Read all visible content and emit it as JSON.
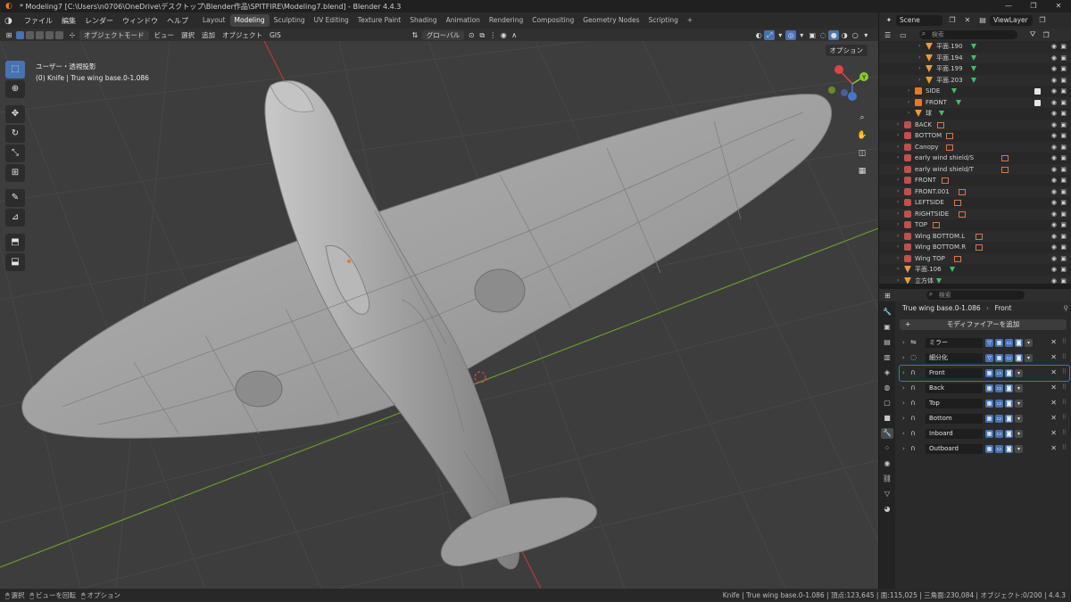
{
  "window": {
    "title": "* Modeling7 [C:\\Users\\n0706\\OneDrive\\デスクトップ\\Blender作品\\SPITFIRE\\Modeling7.blend] - Blender 4.4.3"
  },
  "menubar": {
    "items": [
      "ファイル",
      "編集",
      "レンダー",
      "ウィンドウ",
      "ヘルプ"
    ],
    "workspaces": [
      "Layout",
      "Modeling",
      "Sculpting",
      "UV Editing",
      "Texture Paint",
      "Shading",
      "Animation",
      "Rendering",
      "Compositing",
      "Geometry Nodes",
      "Scripting"
    ],
    "active_workspace": "Modeling",
    "add_workspace": "+"
  },
  "scenebar": {
    "scene": "Scene",
    "view_layer": "ViewLayer"
  },
  "viewport_header": {
    "mode": "オブジェクトモード",
    "menus": [
      "ビュー",
      "選択",
      "追加",
      "オブジェクト",
      "GIS"
    ],
    "orientation": "グローバル",
    "options": "オプション"
  },
  "viewport": {
    "view_name": "ユーザー・透視投影",
    "active_info": "(0) Knife | True wing base.0-1.086",
    "gizmo": {
      "x": "X",
      "y": "Y",
      "z": "Z"
    },
    "colors": {
      "background": "#3d3d3d",
      "grid": "#474747",
      "x_axis": "#b33a3a",
      "y_axis": "#6a9a2a",
      "model": "#a3a3a3",
      "select": "#4772b3"
    }
  },
  "tools": [
    "select-box",
    "cursor",
    "move",
    "rotate",
    "scale",
    "transform",
    "annotate",
    "measure",
    "add-cube",
    "extrude"
  ],
  "outliner": {
    "search_placeholder": "検索",
    "rows": [
      {
        "label": "平面.190",
        "indent": 4,
        "type": "mesh",
        "checks": false
      },
      {
        "label": "平面.194",
        "indent": 4,
        "type": "mesh",
        "checks": false
      },
      {
        "label": "平面.199",
        "indent": 4,
        "type": "mesh",
        "checks": false
      },
      {
        "label": "平面.203",
        "indent": 4,
        "type": "mesh",
        "checks": false
      },
      {
        "label": "SIDE",
        "indent": 3,
        "type": "obj",
        "checks": true
      },
      {
        "label": "FRONT",
        "indent": 3,
        "type": "obj",
        "checks": true
      },
      {
        "label": "球",
        "indent": 3,
        "type": "mesh",
        "checks": false
      },
      {
        "label": "BACK",
        "indent": 2,
        "type": "img",
        "checks": false
      },
      {
        "label": "BOTTOM",
        "indent": 2,
        "type": "img",
        "checks": false
      },
      {
        "label": "Canopy",
        "indent": 2,
        "type": "img",
        "checks": false
      },
      {
        "label": "early wind shield/S",
        "indent": 2,
        "type": "img",
        "checks": false
      },
      {
        "label": "early wind shield/T",
        "indent": 2,
        "type": "img",
        "checks": false
      },
      {
        "label": "FRONT",
        "indent": 2,
        "type": "img",
        "checks": false
      },
      {
        "label": "FRONT.001",
        "indent": 2,
        "type": "img",
        "checks": false
      },
      {
        "label": "LEFTSIDE",
        "indent": 2,
        "type": "img",
        "checks": false
      },
      {
        "label": "RIGHTSIDE",
        "indent": 2,
        "type": "img",
        "checks": false
      },
      {
        "label": "TOP",
        "indent": 2,
        "type": "img",
        "checks": false
      },
      {
        "label": "Wing BOTTOM.L",
        "indent": 2,
        "type": "img",
        "checks": false
      },
      {
        "label": "Wing BOTTOM.R",
        "indent": 2,
        "type": "img",
        "checks": false
      },
      {
        "label": "Wing TOP",
        "indent": 2,
        "type": "img",
        "checks": false
      },
      {
        "label": "平面.106",
        "indent": 2,
        "type": "mesh",
        "checks": false
      },
      {
        "label": "立方体",
        "indent": 2,
        "type": "mesh",
        "checks": false
      }
    ]
  },
  "properties": {
    "search_placeholder": "検索",
    "object": "True wing base.0-1.086",
    "active_modifier": "Front",
    "add_modifier": "モディファイアーを追加",
    "modifiers": [
      {
        "name": "ミラー",
        "icon": "mirror",
        "selected": false
      },
      {
        "name": "細分化",
        "icon": "subsurf",
        "selected": false
      },
      {
        "name": "Front",
        "icon": "shrinkwrap",
        "selected": true
      },
      {
        "name": "Back",
        "icon": "shrinkwrap",
        "selected": false
      },
      {
        "name": "Top",
        "icon": "shrinkwrap",
        "selected": false
      },
      {
        "name": "Bottom",
        "icon": "shrinkwrap",
        "selected": false
      },
      {
        "name": "Inboard",
        "icon": "shrinkwrap",
        "selected": false
      },
      {
        "name": "Outboard",
        "icon": "shrinkwrap",
        "selected": false
      }
    ]
  },
  "statusbar": {
    "left": [
      "選択",
      "ビューを回転",
      "オプション"
    ],
    "right": "Knife | True wing base.0-1.086 | 頂点:123,645 | 面:115,025 | 三角面:230,084 | オブジェクト:0/200 | 4.4.3"
  }
}
